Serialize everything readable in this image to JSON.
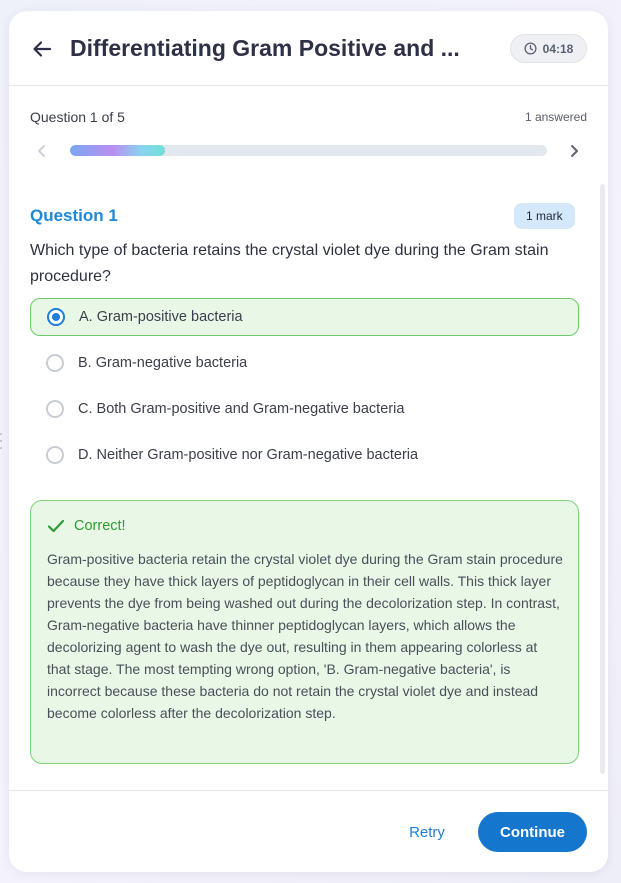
{
  "header": {
    "title": "Differentiating Gram Positive and ...",
    "timer": "04:18",
    "icons": {
      "back": "arrow-left-icon",
      "timer": "clock-icon"
    }
  },
  "progress": {
    "label": "Question 1 of 5",
    "answered": "1 answered",
    "fraction": 0.2
  },
  "question": {
    "number_label": "Question 1",
    "mark": "1 mark",
    "text": "Which type of bacteria retains the crystal violet dye during the Gram stain procedure?",
    "options": [
      {
        "label": "A. Gram-positive bacteria",
        "selected": true
      },
      {
        "label": "B. Gram-negative bacteria",
        "selected": false
      },
      {
        "label": "C. Both Gram-positive and Gram-negative bacteria",
        "selected": false
      },
      {
        "label": "D. Neither Gram-positive nor Gram-negative bacteria",
        "selected": false
      }
    ]
  },
  "feedback": {
    "status": "Correct!",
    "explanation": "Gram-positive bacteria retain the crystal violet dye during the Gram stain procedure because they have thick layers of peptidoglycan in their cell walls. This thick layer prevents the dye from being washed out during the decolorization step. In contrast, Gram-negative bacteria have thinner peptidoglycan layers, which allows the decolorizing agent to wash the dye out, resulting in them appearing colorless at that stage. The most tempting wrong option, 'B. Gram-negative bacteria', is incorrect because these bacteria do not retain the crystal violet dye and instead become colorless after the decolorization step."
  },
  "footer": {
    "retry_label": "Retry",
    "continue_label": "Continue"
  },
  "colors": {
    "accent": "#1476cc",
    "question_title": "#1e88d8",
    "correct": "#2f9b34",
    "correct_bg": "#e8f7e6"
  }
}
